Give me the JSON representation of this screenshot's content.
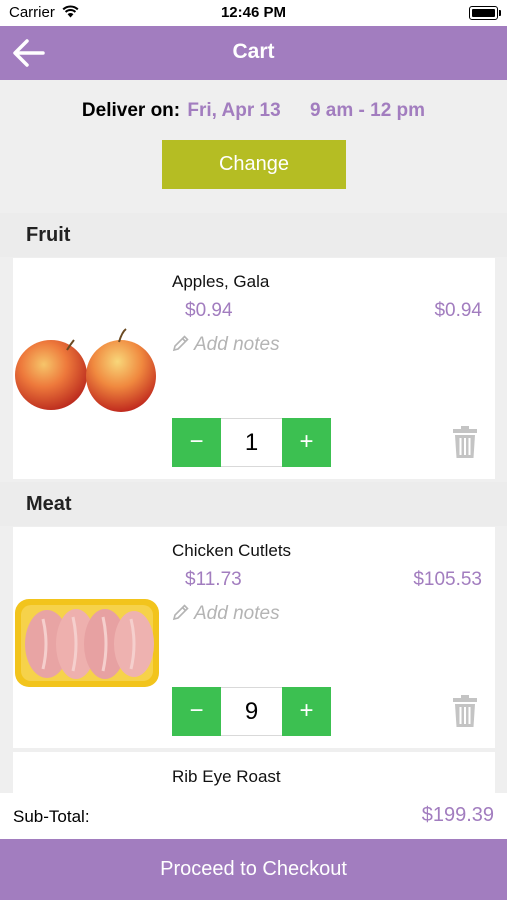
{
  "status_bar": {
    "carrier": "Carrier",
    "time": "12:46 PM"
  },
  "nav": {
    "title": "Cart"
  },
  "delivery": {
    "label": "Deliver on:",
    "date": "Fri, Apr 13",
    "time_slot": "9 am - 12 pm",
    "change_label": "Change"
  },
  "sections": [
    {
      "name": "Fruit",
      "items": [
        {
          "name": "Apples, Gala",
          "unit_price": "$0.94",
          "total_price": "$0.94",
          "notes_placeholder": "Add notes",
          "quantity": "1"
        }
      ]
    },
    {
      "name": "Meat",
      "items": [
        {
          "name": "Chicken Cutlets",
          "unit_price": "$11.73",
          "total_price": "$105.53",
          "notes_placeholder": "Add notes",
          "quantity": "9"
        },
        {
          "name": "Rib Eye Roast"
        }
      ]
    }
  ],
  "stepper": {
    "minus": "−",
    "plus": "+"
  },
  "subtotal": {
    "label": "Sub-Total:",
    "value": "$199.39"
  },
  "checkout_label": "Proceed to Checkout",
  "colors": {
    "brand_purple": "#a27dbf",
    "change_button": "#b5bd23",
    "stepper_green": "#3cc051"
  }
}
